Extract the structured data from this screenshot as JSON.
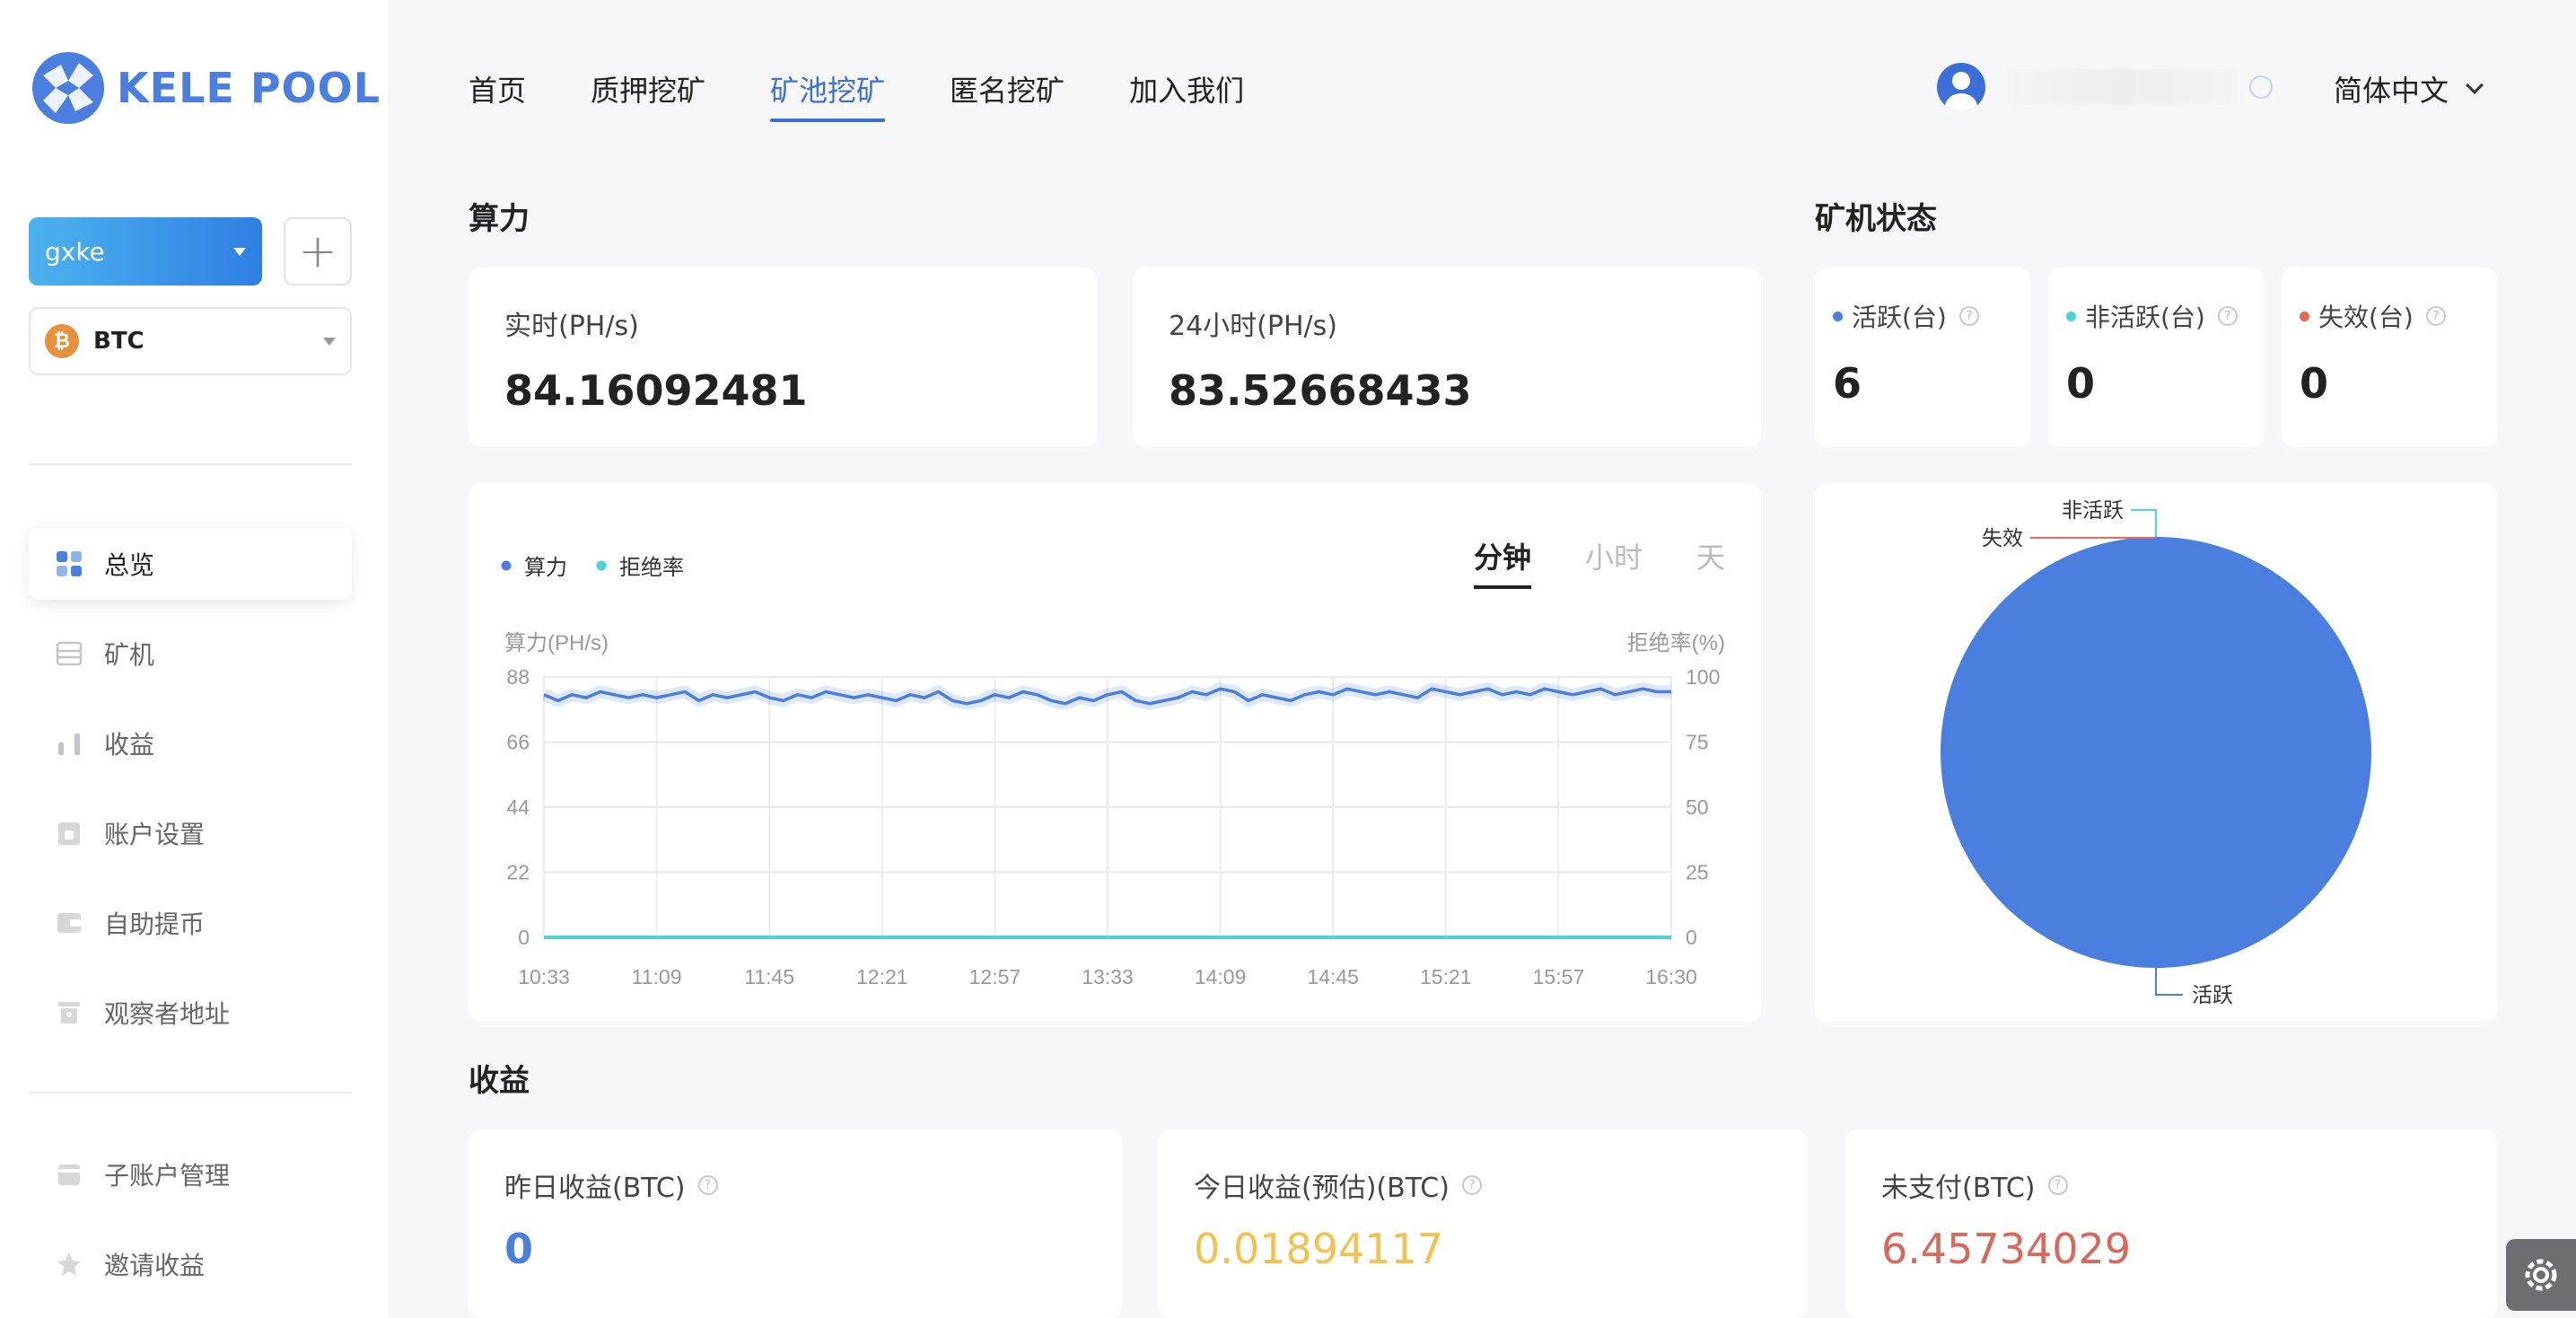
{
  "brand": {
    "name": "KELE POOL",
    "accent": "#4a7fe0"
  },
  "sidebar": {
    "account": "gxke",
    "coin": {
      "symbol": "₿",
      "name": "BTC"
    },
    "items": [
      {
        "label": "总览",
        "icon": "dashboard-icon",
        "active": true
      },
      {
        "label": "矿机",
        "icon": "miner-list-icon"
      },
      {
        "label": "收益",
        "icon": "bar-chart-icon"
      },
      {
        "label": "账户设置",
        "icon": "account-settings-icon"
      },
      {
        "label": "自助提币",
        "icon": "wallet-icon"
      },
      {
        "label": "观察者地址",
        "icon": "watcher-icon"
      },
      {
        "label": "子账户管理",
        "icon": "sub-account-icon"
      },
      {
        "label": "邀请收益",
        "icon": "star-icon"
      }
    ]
  },
  "topnav": {
    "items": [
      "首页",
      "质押挖矿",
      "矿池挖矿",
      "匿名挖矿",
      "加入我们"
    ],
    "active": "矿池挖矿",
    "language": "简体中文"
  },
  "hashrate": {
    "title": "算力",
    "realtime_label": "实时(PH/s)",
    "realtime_value": "84.16092481",
    "day_label": "24小时(PH/s)",
    "day_value": "83.52668433"
  },
  "miner_status": {
    "title": "矿机状态",
    "active": {
      "label": "活跃(台)",
      "value": "6",
      "color": "#4a7fe0"
    },
    "inactive": {
      "label": "非活跃(台)",
      "value": "0",
      "color": "#4fd3d8"
    },
    "invalid": {
      "label": "失效(台)",
      "value": "0",
      "color": "#e06b58"
    }
  },
  "chart_tabs": {
    "minute": "分钟",
    "hour": "小时",
    "day": "天",
    "active": "分钟"
  },
  "chart_data": [
    {
      "type": "line",
      "legend": [
        "算力",
        "拒绝率"
      ],
      "ylabel": "算力(PH/s)",
      "y2label": "拒绝率(%)",
      "ylim": [
        0,
        88
      ],
      "y2lim": [
        0,
        100
      ],
      "yticks": [
        "88",
        "66",
        "44",
        "22",
        "0"
      ],
      "y2ticks": [
        "100",
        "75",
        "50",
        "25",
        "0"
      ],
      "xticks": [
        "10:33",
        "11:09",
        "11:45",
        "12:21",
        "12:57",
        "13:33",
        "14:09",
        "14:45",
        "15:21",
        "15:57",
        "16:30"
      ],
      "series": [
        {
          "name": "算力",
          "color": "#4a7fe0",
          "values": [
            82,
            80,
            82,
            81,
            83,
            82,
            81,
            82,
            81,
            82,
            83,
            80,
            82,
            81,
            82,
            83,
            81,
            80,
            82,
            81,
            83,
            82,
            81,
            82,
            81,
            80,
            82,
            81,
            83,
            80,
            79,
            80,
            82,
            81,
            83,
            82,
            80,
            79,
            81,
            80,
            82,
            83,
            80,
            79,
            80,
            81,
            83,
            82,
            84,
            83,
            80,
            82,
            81,
            80,
            82,
            83,
            82,
            84,
            83,
            82,
            83,
            82,
            81,
            84,
            83,
            82,
            83,
            84,
            82,
            83,
            82,
            84,
            83,
            82,
            83,
            84,
            82,
            83,
            84,
            83,
            83
          ]
        },
        {
          "name": "拒绝率",
          "color": "#4fd3d8",
          "values": [
            0,
            0,
            0,
            0,
            0,
            0,
            0,
            0,
            0,
            0,
            0
          ]
        }
      ]
    },
    {
      "type": "pie",
      "categories": [
        "活跃",
        "非活跃",
        "失效"
      ],
      "values": [
        6,
        0,
        0
      ],
      "colors": [
        "#4a7fe0",
        "#4fd3d8",
        "#e06b58"
      ]
    }
  ],
  "earnings": {
    "title": "收益",
    "yesterday": {
      "label": "昨日收益(BTC)",
      "value": "0",
      "color": "#4a7fe0"
    },
    "today": {
      "label": "今日收益(预估)(BTC)",
      "value": "0.01894117",
      "color": "#f2c14e"
    },
    "unpaid": {
      "label": "未支付(BTC)",
      "value": "6.45734029",
      "color": "#d9675a"
    }
  }
}
